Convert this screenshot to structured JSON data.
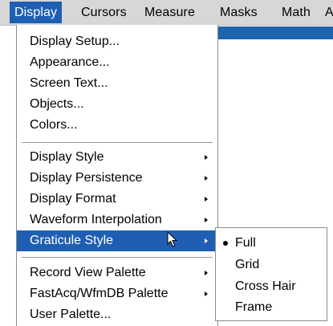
{
  "menubar": {
    "items": [
      {
        "label": "Display"
      },
      {
        "label": "Cursors"
      },
      {
        "label": "Measure"
      },
      {
        "label": "Masks"
      },
      {
        "label": "Math"
      },
      {
        "label": "A"
      }
    ]
  },
  "display_menu": {
    "items": [
      {
        "label": "Display Setup..."
      },
      {
        "label": "Appearance..."
      },
      {
        "label": "Screen Text..."
      },
      {
        "label": "Objects..."
      },
      {
        "label": "Colors..."
      },
      {
        "label": "Display Style"
      },
      {
        "label": "Display Persistence"
      },
      {
        "label": "Display Format"
      },
      {
        "label": "Waveform Interpolation"
      },
      {
        "label": "Graticule Style"
      },
      {
        "label": "Record View Palette"
      },
      {
        "label": "FastAcq/WfmDB Palette"
      },
      {
        "label": "User Palette..."
      }
    ]
  },
  "graticule_submenu": {
    "selected": "Full",
    "items": [
      {
        "label": "Full"
      },
      {
        "label": "Grid"
      },
      {
        "label": "Cross Hair"
      },
      {
        "label": "Frame"
      }
    ]
  },
  "colors": {
    "highlight": "#1f5fb3",
    "menubar_bg": "#d7d7d7",
    "menu_bg": "#ffffff"
  },
  "icons": {
    "submenu_arrow": "right-triangle",
    "pointer": "mouse-pointer-arrow",
    "selected_mark": "bullet"
  }
}
